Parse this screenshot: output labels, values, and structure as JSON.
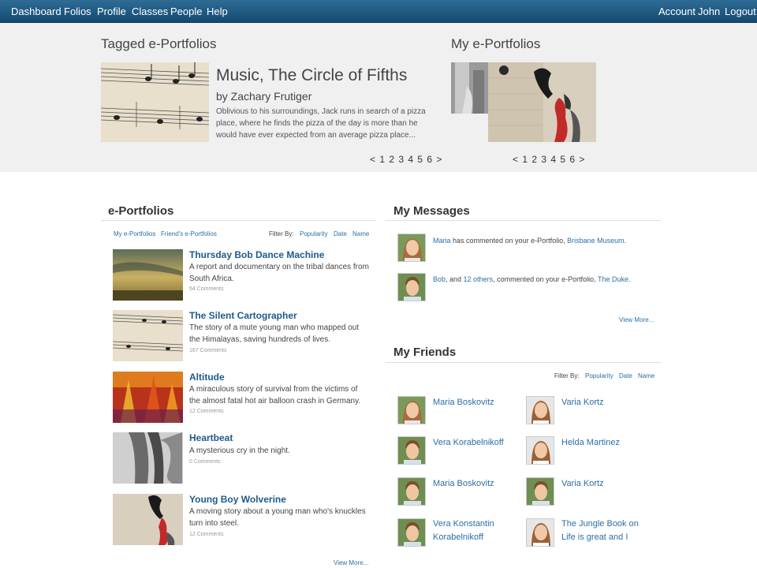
{
  "nav": {
    "left": [
      "Dashboard",
      "Folios",
      "Profile",
      "Classes",
      "People",
      "Help"
    ],
    "right": [
      "Account",
      "John",
      "Logout"
    ]
  },
  "banner": {
    "tagged_title": "Tagged e-Portfolios",
    "my_title": "My e-Portfolios",
    "feature": {
      "title": "Music, The Circle of Fifths",
      "author": "by Zachary Frutiger",
      "description": "Oblivious to his surroundings, Jack runs in search of a pizza place, where he finds the pizza of the day is more than he would have ever expected from an average pizza place..."
    },
    "pager_tagged": "< 1 2 3 4 5 6 >",
    "pager_my": "< 1 2 3 4 5 6 >"
  },
  "portfolios": {
    "title": "e-Portfolios",
    "tabs": [
      "My e-Portfolios",
      "Friend's e-Portfolios"
    ],
    "filter_label": "Filter By:",
    "filters": [
      "Popularity",
      "Date",
      "Name"
    ],
    "items": [
      {
        "title": "Thursday Bob Dance Machine",
        "description": "A report and documentary on the tribal dances from South Africa.",
        "comments": "64 Comments",
        "thumb": "sky"
      },
      {
        "title": "The Silent Cartographer",
        "description": "The story of a mute young man who mapped out the Himalayas, saving hundreds of lives.",
        "comments": "167 Comments",
        "thumb": "music"
      },
      {
        "title": "Altitude",
        "description": "A miraculous story of survival from the victims of the almost fatal hot air balloon crash in Germany.",
        "comments": "12 Comments",
        "thumb": "fire"
      },
      {
        "title": "Heartbeat",
        "description": "A mysterious cry in the night.",
        "comments": "0 Comments",
        "thumb": "elephant"
      },
      {
        "title": "Young Boy Wolverine",
        "description": "A moving story about a young man who's knuckles turn into steel.",
        "comments": "12 Comments",
        "thumb": "art"
      }
    ],
    "view_more": "View More..."
  },
  "messages": {
    "title": "My Messages",
    "items": [
      {
        "actor": "Maria",
        "mid": " has commented on your e-Portfolio, ",
        "target": "Brisbane Museum",
        "end": "."
      },
      {
        "actor": "Bob",
        "mid_a": ", and ",
        "others": "12 others",
        "mid_b": ", commented on your e-Portfolio, ",
        "target": "The Duke",
        "end": "."
      }
    ],
    "view_more": "View More..."
  },
  "friends": {
    "title": "My Friends",
    "filter_label": "Filter By:",
    "filters": [
      "Popularity",
      "Date",
      "Name"
    ],
    "items": [
      {
        "name": "Maria Boskovitz",
        "gender": "girl"
      },
      {
        "name": "Varia Kortz",
        "gender": "girl"
      },
      {
        "name": "Vera Korabelnikoff",
        "gender": "boy"
      },
      {
        "name": "Helda Martinez",
        "gender": "girl"
      },
      {
        "name": "Maria Boskovitz",
        "gender": "boy"
      },
      {
        "name": "Varia Kortz",
        "gender": "boy"
      },
      {
        "name": "Vera Konstantin Korabelnikoff",
        "gender": "boy"
      },
      {
        "name": "The Jungle Book on Life is great and I",
        "gender": "girl"
      }
    ]
  },
  "colors": {
    "nav_bg": "#1f5b84",
    "link": "#2a6fa6",
    "title_link": "#1e5a8a",
    "banner_bg": "#f0f0f0"
  }
}
